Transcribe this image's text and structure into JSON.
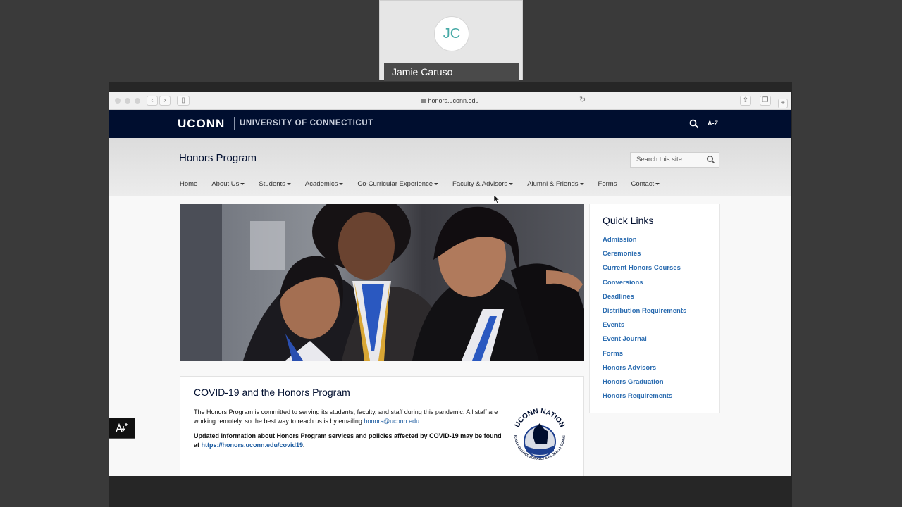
{
  "participant": {
    "initials": "JC",
    "name": "Jamie Caruso"
  },
  "browser": {
    "url": "honors.uconn.edu"
  },
  "uconn_header": {
    "logo": "UCONN",
    "university": "UNIVERSITY OF CONNECTICUT",
    "az_label": "A-Z"
  },
  "site": {
    "title": "Honors Program",
    "search_placeholder": "Search this site...",
    "nav": [
      {
        "label": "Home"
      },
      {
        "label": "About Us"
      },
      {
        "label": "Students"
      },
      {
        "label": "Academics"
      },
      {
        "label": "Co-Curricular Experience"
      },
      {
        "label": "Faculty & Advisors"
      },
      {
        "label": "Alumni & Friends"
      },
      {
        "label": "Forms"
      },
      {
        "label": "Contact"
      }
    ]
  },
  "covid": {
    "heading": "COVID-19 and the Honors Program",
    "para1": "The Honors Program is committed to serving its students, faculty, and staff during this pandemic. All staff are working remotely, so the best way to reach us is by emailing",
    "email": "honors@uconn.edu",
    "para2": "Updated information about Honors Program services and policies affected by COVID-19 may be found at",
    "link": "https://honors.uconn.edu/covid19",
    "seal_top": "UCONN NATION",
    "seal_bottom": "PHYSICALLY DISTANT, SOCIALLY & GLOBALLY CONNECTED"
  },
  "quick_links": {
    "title": "Quick Links",
    "items": [
      "Admission",
      "Ceremonies",
      "Current Honors Courses",
      "Conversions",
      "Deadlines",
      "Distribution Requirements",
      "Events",
      "Event Journal",
      "Forms",
      "Honors Advisors",
      "Honors Graduation",
      "Honors Requirements"
    ]
  },
  "colors": {
    "uconn_navy": "#000e2f",
    "link_blue": "#2b6cb0"
  }
}
